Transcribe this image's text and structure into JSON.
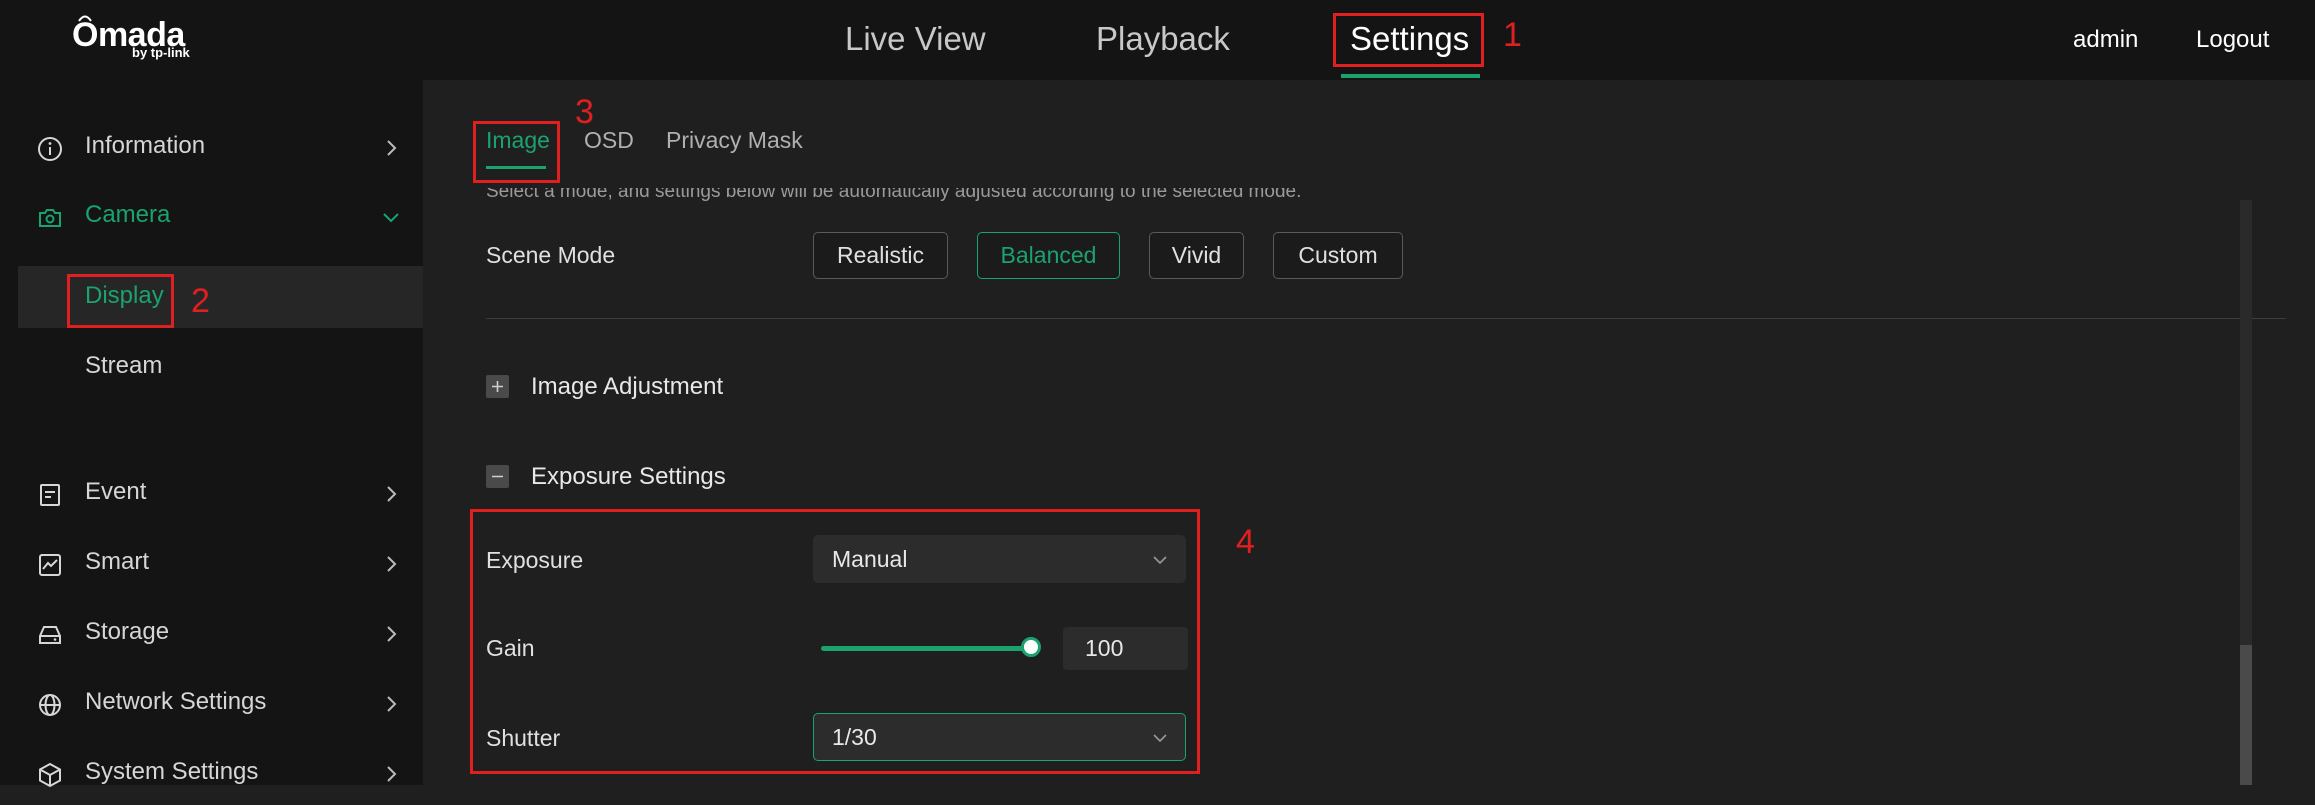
{
  "header": {
    "logo": "Omada",
    "logo_sub": "by tp-link",
    "tabs": [
      "Live View",
      "Playback",
      "Settings"
    ],
    "active_tab": "Settings",
    "user": "admin",
    "logout": "Logout"
  },
  "sidebar": {
    "items": [
      {
        "label": "Information",
        "icon": "info-icon"
      },
      {
        "label": "Camera",
        "icon": "camera-icon"
      },
      {
        "label": "Display"
      },
      {
        "label": "Stream"
      },
      {
        "label": "Event",
        "icon": "event-icon"
      },
      {
        "label": "Smart",
        "icon": "smart-icon"
      },
      {
        "label": "Storage",
        "icon": "storage-icon"
      },
      {
        "label": "Network Settings",
        "icon": "globe-icon"
      },
      {
        "label": "System Settings",
        "icon": "cube-icon"
      }
    ]
  },
  "main": {
    "tabs": [
      "Image",
      "OSD",
      "Privacy Mask"
    ],
    "active_tab": "Image",
    "description": "Select a mode, and settings below will be automatically adjusted according to the selected mode.",
    "scene_mode_label": "Scene Mode",
    "scene_modes": [
      "Realistic",
      "Balanced",
      "Vivid",
      "Custom"
    ],
    "selected_scene_mode": "Balanced",
    "image_adjustment": "Image Adjustment",
    "exposure_settings": "Exposure Settings",
    "exposure_label": "Exposure",
    "exposure_value": "Manual",
    "gain_label": "Gain",
    "gain_value": "100",
    "gain_level": 1.0,
    "shutter_label": "Shutter",
    "shutter_value": "1/30"
  },
  "annotations": [
    "1",
    "2",
    "3",
    "4"
  ],
  "colors": {
    "accent": "#1aa36f",
    "annotation": "#e02020",
    "background": "#1f1f1f",
    "sidebar": "#141414"
  }
}
